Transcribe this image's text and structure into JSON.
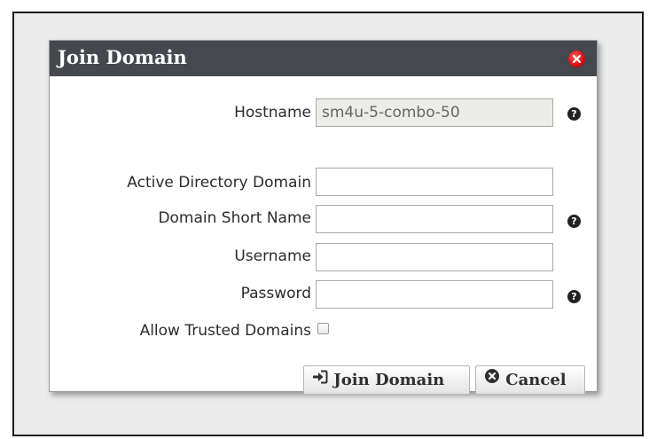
{
  "dialog": {
    "title": "Join Domain",
    "close_icon": "close-icon"
  },
  "fields": {
    "hostname": {
      "label": "Hostname",
      "value": "sm4u-5-combo-50",
      "has_help": true
    },
    "ad_domain": {
      "label": "Active Directory Domain",
      "value": ""
    },
    "short_name": {
      "label": "Domain Short Name",
      "value": "",
      "has_help": true
    },
    "username": {
      "label": "Username",
      "value": ""
    },
    "password": {
      "label": "Password",
      "value": "",
      "has_help": true
    },
    "trusted": {
      "label": "Allow Trusted Domains",
      "checked": false
    }
  },
  "help_glyph": "?",
  "buttons": {
    "join_label": "Join Domain",
    "join_icon": "sign-in-icon",
    "cancel_label": "Cancel",
    "cancel_icon": "circle-x-icon"
  },
  "colors": {
    "titlebar": "#45484d",
    "close": "#d60f0f",
    "readonly_bg": "#ecece8"
  }
}
